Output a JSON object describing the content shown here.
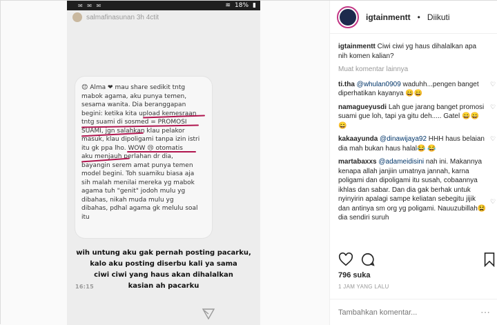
{
  "story": {
    "status_time": "16:15",
    "status_battery": "18%",
    "story_username": "salmafinasunan  3h 4ctit",
    "bubble_lines": [
      "😊 Alma ❤ mau share sedikit tntg",
      "mabok agama, aku punya temen,",
      "sesama wanita. Dia beranggapan",
      "begini: ketika kita upload kemesraan",
      "tntg suami di sosmed = PROMOSI",
      "SUAMI, jgn salahkan klau pelakor",
      "masuk, klau dipoligami tanpa izin istri",
      "itu gk ppa lho. WOW 😢 otomatis",
      "aku menjauh perlahan dr dia,",
      "bayangin serem amat punya temen",
      "model begini. Toh suamiku biasa aja",
      "sih malah menilai mereka yg mabok",
      "agama tuh \"genit\" jodoh mulu yg",
      "dibahas, nikah muda mulu yg",
      "dibahas, pdhal agama gk melulu soal",
      "itu"
    ],
    "caption_lines": [
      "wih untung aku gak pernah posting pacarku,",
      "kalo aku posting diserbu kali ya sama",
      "ciwi ciwi yang haus akan dihalalkan",
      "kasian ah pacarku"
    ]
  },
  "panel": {
    "username": "igtainmentt",
    "follow_status": "Diikuti",
    "caption_user": "igtainmentt",
    "caption_text": "Ciwi ciwi yg haus dihalalkan apa nih komen kalian?",
    "load_more": "Muat komentar lainnya",
    "comments": [
      {
        "user": "ti.tha",
        "mention": "@whulan0909",
        "text": "waduhh...pengen banget diperhatikan kayanya 😄😄"
      },
      {
        "user": "namagueyusdi",
        "mention": "",
        "text": "Lah gue jarang banget promosi suami gue loh, tapi ya gitu deh..... Gatel 😄😄😄"
      },
      {
        "user": "kakaayunda",
        "mention": "@dinawijaya92",
        "text": "HHH haus belaian dia mah bukan haus halal😂 😂"
      },
      {
        "user": "martabaxxs",
        "mention": "@adameidisini",
        "text": "nah ini. Makannya kenapa allah janjiin umatnya jannah, karna poligami dan dipoligami itu susah, cobaannya ikhlas dan sabar. Dan dia gak berhak untuk nyinyirin apalagi sampe keliatan sebegitu jijik dan antinya sm org yg poligami. Nauuzubillah😫 dia sendiri suruh"
      }
    ],
    "likes": "796 suka",
    "timestamp": "1 JAM YANG LALU",
    "comment_placeholder": "Tambahkan komentar...",
    "more_icon": "ellipsis-icon"
  }
}
